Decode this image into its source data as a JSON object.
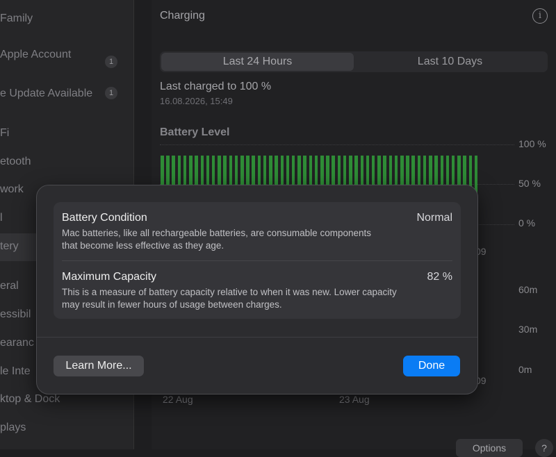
{
  "sidebar": {
    "items": [
      {
        "label": "Family"
      },
      {
        "label": "Apple Account"
      },
      {
        "label": "e Update Available"
      },
      {
        "label": "Fi"
      },
      {
        "label": "etooth"
      },
      {
        "label": "work"
      },
      {
        "label": "l"
      },
      {
        "label": "tery"
      },
      {
        "label": "eral"
      },
      {
        "label": "essibil"
      },
      {
        "label": "earanc"
      },
      {
        "label": "le Inte"
      },
      {
        "label": "ktop & Dock"
      },
      {
        "label": "plays"
      }
    ],
    "badges": [
      "1",
      "1"
    ]
  },
  "main": {
    "title": "Charging",
    "tabs": [
      {
        "label": "Last 24 Hours",
        "active": true
      },
      {
        "label": "Last 10 Days",
        "active": false
      }
    ],
    "last_charged": "Last charged to 100 %",
    "last_charged_date": "16.08.2026, 15:49",
    "battery_level_label": "Battery Level",
    "y_ticks_top": [
      "100 %",
      "50 %",
      "0 %"
    ],
    "y_ticks_bottom": [
      "60m",
      "30m",
      "0m"
    ],
    "partial_label_top": "09",
    "partial_label_bottom": "09",
    "dates": [
      "22 Aug",
      "23 Aug"
    ],
    "options_label": "Options",
    "help_label": "?"
  },
  "chart_data": {
    "type": "bar",
    "title": "Battery Level",
    "ylim": [
      0,
      100
    ],
    "y_ticks": [
      "100 %",
      "50 %",
      "0 %"
    ],
    "bar_count": 56,
    "values": [
      84,
      84,
      84,
      84,
      84,
      84,
      84,
      84,
      84,
      84,
      84,
      84,
      84,
      84,
      84,
      84,
      84,
      84,
      84,
      84,
      84,
      84,
      84,
      84,
      84,
      84,
      84,
      84,
      84,
      84,
      84,
      84,
      84,
      84,
      84,
      84,
      84,
      84,
      84,
      84,
      84,
      84,
      84,
      84,
      84,
      84,
      84,
      84,
      84,
      84,
      84,
      84,
      84,
      84,
      84,
      84
    ],
    "color": "#2e8c36"
  },
  "modal": {
    "battery_condition_title": "Battery Condition",
    "battery_condition_value": "Normal",
    "battery_condition_desc": "Mac batteries, like all rechargeable batteries, are consumable components that become less effective as they age.",
    "max_capacity_title": "Maximum Capacity",
    "max_capacity_value": "82 %",
    "max_capacity_desc": "This is a measure of battery capacity relative to when it was new. Lower capacity may result in fewer hours of usage between charges.",
    "learn_more_label": "Learn More...",
    "done_label": "Done"
  },
  "colors": {
    "accent": "#0a7cf4",
    "battery_green": "#2e8c36"
  }
}
